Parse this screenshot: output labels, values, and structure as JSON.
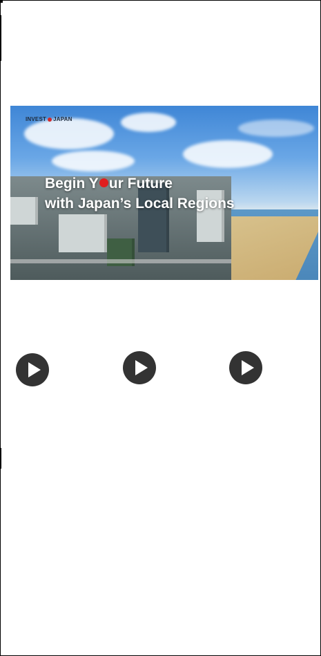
{
  "banner": {
    "logo_text_left": "INVEST",
    "logo_text_right": "JAPAN",
    "headline_line1_a": "Begin Y",
    "headline_line1_b": "ur Future",
    "headline_line2": "with Japan’s Local Regions",
    "accent_color": "#e01e1e"
  },
  "videos": [
    {
      "icon": "play-icon"
    },
    {
      "icon": "play-icon"
    },
    {
      "icon": "play-icon"
    }
  ],
  "colors": {
    "play_button": "#333333",
    "border": "#000000"
  }
}
